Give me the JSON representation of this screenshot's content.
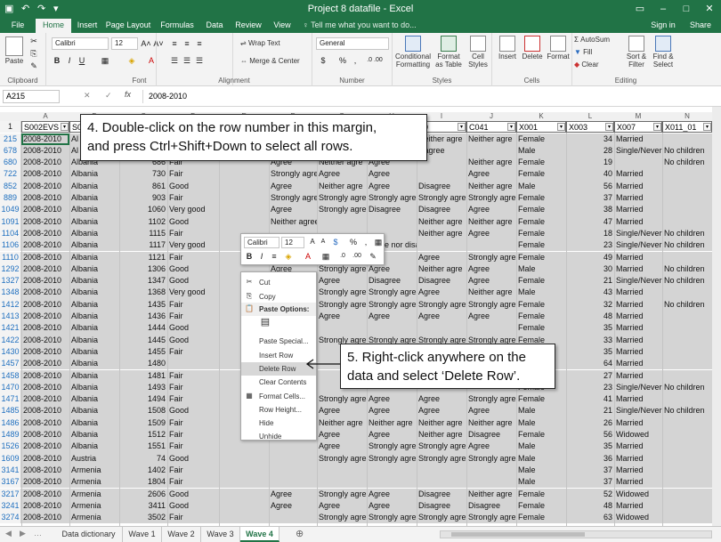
{
  "titlebar": {
    "title": "Project 8 datafile - Excel",
    "save_icon": "save-icon",
    "undo": "↶",
    "redo": "↷",
    "customize": "▾",
    "min": "–",
    "max": "□",
    "close": "✕"
  },
  "menu": {
    "tabs": [
      "File",
      "Home",
      "Insert",
      "Page Layout",
      "Formulas",
      "Data",
      "Review",
      "View"
    ],
    "active": "Home",
    "tell_me": "♀ Tell me what you want to do...",
    "sign_in": "Sign in",
    "share": "Share"
  },
  "ribbon": {
    "clipboard": {
      "paste": "Paste",
      "label": "Clipboard"
    },
    "font": {
      "name": "Calibri",
      "size": "12",
      "bold": "B",
      "italic": "I",
      "underline": "U",
      "grow": "A˄",
      "shrink": "A˅",
      "label": "Font"
    },
    "alignment": {
      "wrap": "Wrap Text",
      "merge": "Merge & Center",
      "label": "Alignment"
    },
    "number": {
      "format": "General",
      "currency": "$",
      "percent": "%",
      "comma": ",",
      "inc": ".0 .00",
      "label": "Number"
    },
    "styles": {
      "cond": "Conditional Formatting",
      "table": "Format as Table",
      "cell": "Cell Styles",
      "label": "Styles"
    },
    "cells": {
      "insert": "Insert",
      "delete": "Delete",
      "format": "Format",
      "label": "Cells"
    },
    "editing": {
      "autosum": "AutoSum",
      "fill": "Fill",
      "clear": "Clear",
      "sort": "Sort & Filter",
      "find": "Find & Select",
      "label": "Editing"
    }
  },
  "formula_bar": {
    "name_box": "A215",
    "value": "2008-2010",
    "cancel": "✕",
    "enter": "✓",
    "fx": "fx"
  },
  "columns": [
    "A",
    "B",
    "C",
    "D",
    "E",
    "F",
    "G",
    "H",
    "I",
    "J",
    "K",
    "L",
    "M",
    "N"
  ],
  "header_row": {
    "num": "1",
    "cells": [
      "S002EVS",
      "S0",
      "",
      "",
      "",
      "",
      "",
      "",
      "39",
      "C041",
      "X001",
      "X003",
      "X007",
      "X011_01"
    ]
  },
  "rows": [
    {
      "num": "215",
      "c": [
        "2008-2010",
        "Al",
        "",
        "",
        "",
        "",
        "",
        "",
        "Neither agre",
        "Neither agre",
        "Female",
        "34",
        "Married",
        ""
      ]
    },
    {
      "num": "678",
      "c": [
        "2008-2010",
        "Al",
        "",
        "",
        "",
        "",
        "",
        "",
        "isagree",
        "",
        "Male",
        "28",
        "Single/Never",
        "No children"
      ]
    },
    {
      "num": "680",
      "c": [
        "2008-2010",
        "Albania",
        "686",
        "Fair",
        "",
        "Agree",
        "Neither agre",
        "Agree",
        "",
        "Neither agre",
        "Female",
        "19",
        "",
        "No children"
      ]
    },
    {
      "num": "722",
      "c": [
        "2008-2010",
        "Albania",
        "730",
        "Fair",
        "",
        "Strongly agre",
        "Agree",
        "Agree",
        "",
        "Agree",
        "Female",
        "40",
        "Married",
        ""
      ]
    },
    {
      "num": "852",
      "c": [
        "2008-2010",
        "Albania",
        "861",
        "Good",
        "",
        "Agree",
        "Neither agre",
        "Agree",
        "Disagree",
        "Neither agre",
        "Male",
        "56",
        "Married",
        ""
      ]
    },
    {
      "num": "889",
      "c": [
        "2008-2010",
        "Albania",
        "903",
        "Fair",
        "",
        "Strongly agre",
        "Strongly agre",
        "Strongly agre",
        "Strongly agre",
        "Strongly agre",
        "Female",
        "37",
        "Married",
        ""
      ]
    },
    {
      "num": "1049",
      "c": [
        "2008-2010",
        "Albania",
        "1060",
        "Very good",
        "",
        "Agree",
        "Strongly agre",
        "Disagree",
        "Disagree",
        "Agree",
        "Female",
        "38",
        "Married",
        ""
      ]
    },
    {
      "num": "1091",
      "c": [
        "2008-2010",
        "Albania",
        "1102",
        "Good",
        "",
        "Neither agree nor disagree",
        "",
        "",
        "Neither agre",
        "Neither agre",
        "Female",
        "47",
        "Married",
        ""
      ]
    },
    {
      "num": "1104",
      "c": [
        "2008-2010",
        "Albania",
        "1115",
        "Fair",
        "",
        "",
        "",
        "",
        "Neither agre",
        "Agree",
        "Female",
        "18",
        "Single/Never",
        "No children"
      ]
    },
    {
      "num": "1106",
      "c": [
        "2008-2010",
        "Albania",
        "1117",
        "Very good",
        "",
        "",
        "",
        "agree nor disagree",
        "",
        "",
        "Female",
        "23",
        "Single/Never",
        "No children"
      ]
    },
    {
      "num": "1110",
      "c": [
        "2008-2010",
        "Albania",
        "1121",
        "Fair",
        "",
        "",
        "",
        "",
        "Agree",
        "Strongly agre",
        "Female",
        "49",
        "Married",
        ""
      ]
    },
    {
      "num": "1292",
      "c": [
        "2008-2010",
        "Albania",
        "1306",
        "Good",
        "",
        "Agree",
        "Strongly agre",
        "Agree",
        "Neither agre",
        "Agree",
        "Male",
        "30",
        "Married",
        "No children"
      ]
    },
    {
      "num": "1327",
      "c": [
        "2008-2010",
        "Albania",
        "1347",
        "Good",
        "",
        "Agree",
        "Agree",
        "Disagree",
        "Disagree",
        "Agree",
        "Female",
        "21",
        "Single/Never",
        "No children"
      ]
    },
    {
      "num": "1348",
      "c": [
        "2008-2010",
        "Albania",
        "1368",
        "Very good",
        "",
        "Agree",
        "Strongly agre",
        "Strongly agre",
        "Agree",
        "Neither agre",
        "Male",
        "43",
        "Married",
        ""
      ]
    },
    {
      "num": "1412",
      "c": [
        "2008-2010",
        "Albania",
        "1435",
        "Fair",
        "",
        "Agree",
        "Strongly agre",
        "Strongly agre",
        "Strongly agre",
        "Strongly agre",
        "Female",
        "32",
        "Married",
        "No children"
      ]
    },
    {
      "num": "1413",
      "c": [
        "2008-2010",
        "Albania",
        "1436",
        "Fair",
        "",
        "",
        "Agree",
        "Agree",
        "Agree",
        "Agree",
        "Female",
        "48",
        "Married",
        ""
      ]
    },
    {
      "num": "1421",
      "c": [
        "2008-2010",
        "Albania",
        "1444",
        "Good",
        "",
        "",
        "",
        "",
        "",
        "",
        "Female",
        "35",
        "Married",
        ""
      ]
    },
    {
      "num": "1422",
      "c": [
        "2008-2010",
        "Albania",
        "1445",
        "Good",
        "",
        "",
        "Strongly agre",
        "Strongly agre",
        "Strongly agre",
        "Strongly agre",
        "Female",
        "33",
        "Married",
        ""
      ]
    },
    {
      "num": "1430",
      "c": [
        "2008-2010",
        "Albania",
        "1455",
        "Fair",
        "",
        "",
        "",
        "",
        "",
        "",
        "Female",
        "35",
        "Married",
        ""
      ]
    },
    {
      "num": "1457",
      "c": [
        "2008-2010",
        "Albania",
        "1480",
        "",
        "",
        "",
        "",
        "",
        "",
        "",
        "Female",
        "64",
        "Married",
        ""
      ]
    },
    {
      "num": "1458",
      "c": [
        "2008-2010",
        "Albania",
        "1481",
        "Fair",
        "",
        "",
        "",
        "",
        "",
        "",
        "Female",
        "27",
        "Married",
        ""
      ]
    },
    {
      "num": "1470",
      "c": [
        "2008-2010",
        "Albania",
        "1493",
        "Fair",
        "",
        "",
        "",
        "",
        "",
        "",
        "Female",
        "23",
        "Single/Never",
        "No children"
      ]
    },
    {
      "num": "1471",
      "c": [
        "2008-2010",
        "Albania",
        "1494",
        "Fair",
        "",
        "",
        "Strongly agre",
        "Agree",
        "Agree",
        "Strongly agre",
        "Female",
        "41",
        "Married",
        ""
      ]
    },
    {
      "num": "1485",
      "c": [
        "2008-2010",
        "Albania",
        "1508",
        "Good",
        "",
        "",
        "Agree",
        "Agree",
        "Agree",
        "Agree",
        "Male",
        "21",
        "Single/Never",
        "No children"
      ]
    },
    {
      "num": "1486",
      "c": [
        "2008-2010",
        "Albania",
        "1509",
        "Fair",
        "",
        "",
        "Neither agre",
        "Neither agre",
        "Neither agre",
        "Neither agre",
        "Male",
        "26",
        "Married",
        ""
      ]
    },
    {
      "num": "1489",
      "c": [
        "2008-2010",
        "Albania",
        "1512",
        "Fair",
        "",
        "",
        "Agree",
        "Agree",
        "Neither agre",
        "Disagree",
        "Female",
        "56",
        "Widowed",
        ""
      ]
    },
    {
      "num": "1526",
      "c": [
        "2008-2010",
        "Albania",
        "1551",
        "Fair",
        "",
        "",
        "Agree",
        "Strongly agre",
        "Strongly agre",
        "Agree",
        "Male",
        "35",
        "Married",
        ""
      ]
    },
    {
      "num": "1609",
      "c": [
        "2008-2010",
        "Austria",
        "74",
        "Good",
        "",
        "",
        "Strongly agre",
        "Strongly agre",
        "Strongly agre",
        "Strongly agre",
        "Male",
        "36",
        "Married",
        ""
      ]
    },
    {
      "num": "3141",
      "c": [
        "2008-2010",
        "Armenia",
        "1402",
        "Fair",
        "",
        "",
        "",
        "",
        "",
        "",
        "Male",
        "37",
        "Married",
        ""
      ]
    },
    {
      "num": "3167",
      "c": [
        "2008-2010",
        "Armenia",
        "1804",
        "Fair",
        "",
        "",
        "",
        "",
        "",
        "",
        "Male",
        "37",
        "Married",
        ""
      ]
    },
    {
      "num": "3217",
      "c": [
        "2008-2010",
        "Armenia",
        "2606",
        "Good",
        "",
        "Agree",
        "Strongly agre",
        "Agree",
        "Disagree",
        "Neither agre",
        "Female",
        "52",
        "Widowed",
        ""
      ]
    },
    {
      "num": "3241",
      "c": [
        "2008-2010",
        "Armenia",
        "3411",
        "Good",
        "",
        "Agree",
        "Agree",
        "Agree",
        "Disagree",
        "Disagree",
        "Female",
        "48",
        "Married",
        ""
      ]
    },
    {
      "num": "3274",
      "c": [
        "2008-2010",
        "Armenia",
        "3502",
        "Fair",
        "",
        "",
        "Strongly agre",
        "Strongly agre",
        "Strongly agre",
        "Strongly agre",
        "Female",
        "63",
        "Widowed",
        ""
      ]
    }
  ],
  "callout1": {
    "line1": "4. Double-click on the row number in this margin,",
    "line2": "and press Ctrl+Shift+Down to select all rows."
  },
  "callout2": {
    "line1": "5. Right-click anywhere on the",
    "line2": "data and select ‘Delete Row’."
  },
  "mini_toolbar": {
    "font": "Calibri",
    "size": "12",
    "bold": "B",
    "italic": "I"
  },
  "context_menu": [
    {
      "label": "Cut",
      "icon": "scissors-icon",
      "glyph": "✂"
    },
    {
      "label": "Copy",
      "icon": "copy-icon",
      "glyph": "⎘"
    },
    {
      "label": "Paste Options:",
      "icon": "paste-icon",
      "glyph": "📋"
    },
    {
      "label": "",
      "icon": "paste-option-icon",
      "glyph": "▤"
    },
    {
      "label": "Paste Special...",
      "icon": "",
      "glyph": ""
    },
    {
      "label": "Insert Row",
      "icon": "",
      "glyph": ""
    },
    {
      "label": "Delete Row",
      "icon": "",
      "glyph": ""
    },
    {
      "label": "Clear Contents",
      "icon": "",
      "glyph": ""
    },
    {
      "label": "Format Cells...",
      "icon": "format-cells-icon",
      "glyph": "▦"
    },
    {
      "label": "Row Height...",
      "icon": "",
      "glyph": ""
    },
    {
      "label": "Hide",
      "icon": "",
      "glyph": ""
    },
    {
      "label": "Unhide",
      "icon": "",
      "glyph": ""
    }
  ],
  "sheets": {
    "tabs": [
      "Data dictionary",
      "Wave 1",
      "Wave 2",
      "Wave 3",
      "Wave 4"
    ],
    "active": "Wave 4",
    "add": "⊕"
  }
}
